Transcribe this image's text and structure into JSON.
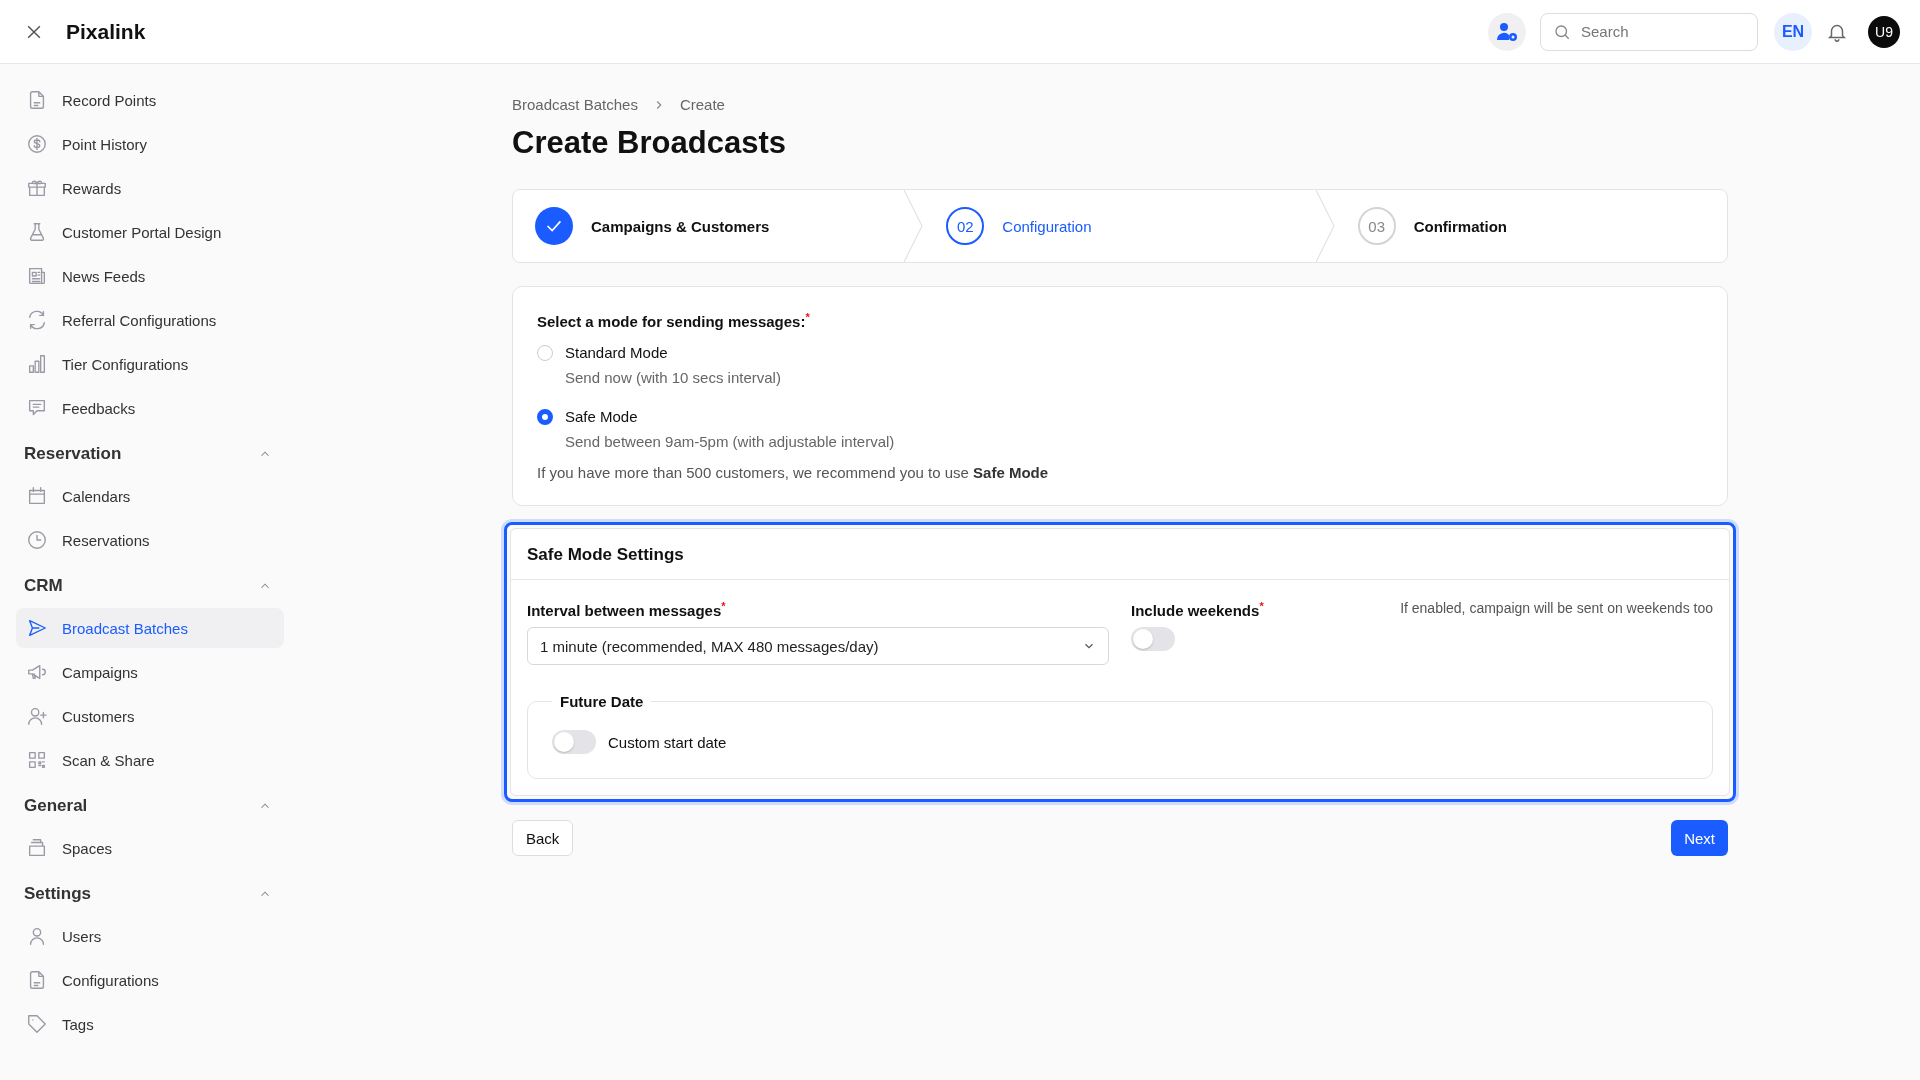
{
  "header": {
    "brand": "Pixalink",
    "search": {
      "placeholder": "Search"
    },
    "language": "EN",
    "avatar": "U9"
  },
  "sidebar": {
    "groups": [
      {
        "items": [
          {
            "label": "Record Points",
            "selected": false
          },
          {
            "label": "Point History",
            "selected": false
          },
          {
            "label": "Rewards",
            "selected": false
          },
          {
            "label": "Customer Portal Design",
            "selected": false
          },
          {
            "label": "News Feeds",
            "selected": false
          },
          {
            "label": "Referral Configurations",
            "selected": false
          },
          {
            "label": "Tier Configurations",
            "selected": false
          },
          {
            "label": "Feedbacks",
            "selected": false
          }
        ]
      },
      {
        "heading": "Reservation",
        "expanded": true,
        "items": [
          {
            "label": "Calendars",
            "selected": false
          },
          {
            "label": "Reservations",
            "selected": false
          }
        ]
      },
      {
        "heading": "CRM",
        "expanded": true,
        "items": [
          {
            "label": "Broadcast Batches",
            "selected": true
          },
          {
            "label": "Campaigns",
            "selected": false
          },
          {
            "label": "Customers",
            "selected": false
          },
          {
            "label": "Scan & Share",
            "selected": false
          }
        ]
      },
      {
        "heading": "General",
        "expanded": true,
        "items": [
          {
            "label": "Spaces",
            "selected": false
          }
        ]
      },
      {
        "heading": "Settings",
        "expanded": true,
        "items": [
          {
            "label": "Users",
            "selected": false
          },
          {
            "label": "Configurations",
            "selected": false
          },
          {
            "label": "Tags",
            "selected": false
          }
        ]
      }
    ]
  },
  "breadcrumb": [
    "Broadcast Batches",
    "Create"
  ],
  "title": "Create Broadcasts",
  "steps": [
    {
      "label": "Campaigns & Customers",
      "completed": true,
      "selected": false
    },
    {
      "number": "02",
      "label": "Configuration",
      "completed": false,
      "selected": true
    },
    {
      "number": "03",
      "label": "Confirmation",
      "completed": false,
      "selected": false
    }
  ],
  "mode_card": {
    "prompt": "Select a mode for sending messages:",
    "required_mark": "*",
    "options": [
      {
        "label": "Standard Mode",
        "description": "Send now (with 10 secs interval)",
        "selected": false
      },
      {
        "label": "Safe Mode",
        "description": "Send between 9am-5pm (with adjustable interval)",
        "selected": true
      }
    ],
    "note": "If you have more than 500 customers, we recommend you to use **Safe Mode**"
  },
  "settings": {
    "title": "Safe Mode Settings",
    "interval": {
      "label": "Interval between messages",
      "required_mark": "*",
      "value": "1 minute (recommended, MAX 480 messages/day)"
    },
    "weekends": {
      "label": "Include weekends",
      "required_mark": "*",
      "on": false,
      "hint": "If enabled, campaign will be sent on weekends too"
    },
    "future_date": {
      "legend": "Future Date",
      "toggle": {
        "label": "Custom start date",
        "on": false
      }
    }
  },
  "buttons": {
    "back": "Back",
    "next": "Next"
  }
}
